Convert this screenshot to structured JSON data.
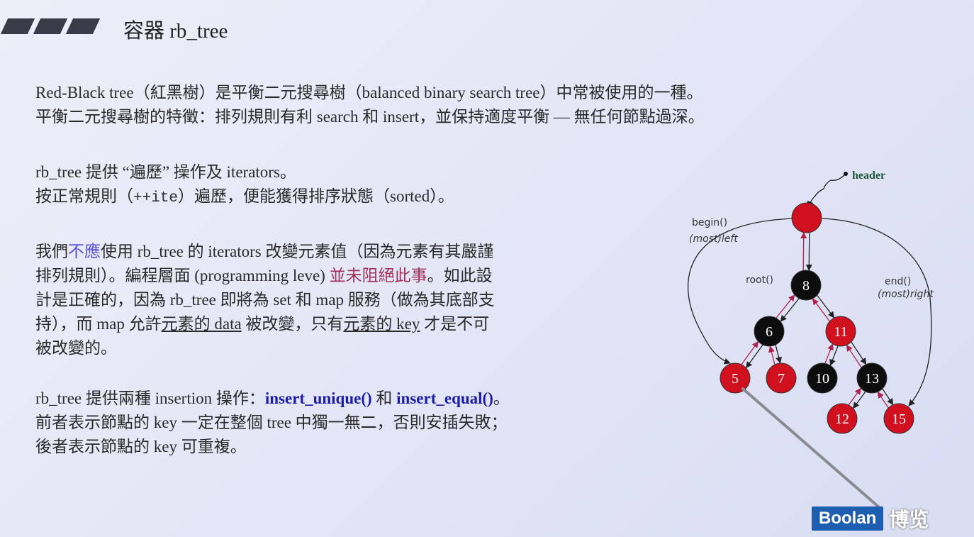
{
  "slide": {
    "title": "容器 rb_tree",
    "paragraphs": [
      [
        [
          {
            "t": "Red-Black tree（紅黑樹）是平衡二元搜尋樹（balanced binary search tree）中常被使用的一種。"
          }
        ],
        [
          {
            "t": "平衡二元搜尋樹的特徵：排列規則有利 search 和 insert，並保持適度平衡 — 無任何節點過深。"
          }
        ]
      ],
      [
        [
          {
            "t": "rb_tree 提供 “遍歷” 操作及 iterators。"
          }
        ],
        [
          {
            "t": "按正常規則（"
          },
          {
            "t": "++ite",
            "s": "mono"
          },
          {
            "t": "）遍歷，便能獲得排序狀態（sorted）。"
          }
        ]
      ],
      [
        [
          {
            "t": "我們"
          },
          {
            "t": "不應",
            "s": "blue"
          },
          {
            "t": "使用 rb_tree 的 iterators 改變元素值（因為元素有其嚴謹"
          }
        ],
        [
          {
            "t": "排列規則）。編程層面 (programming leve) "
          },
          {
            "t": "並未阻絕此事",
            "s": "maroon"
          },
          {
            "t": "。如此設"
          }
        ],
        [
          {
            "t": "計是正確的，因為 rb_tree 即將為 set 和 map 服務（做為其底部支"
          }
        ],
        [
          {
            "t": "持），而 map 允許"
          },
          {
            "t": "元素的 data",
            "s": "ul"
          },
          {
            "t": " 被改變，只有"
          },
          {
            "t": "元素的 key",
            "s": "ul"
          },
          {
            "t": " 才是不可"
          }
        ],
        [
          {
            "t": "被改變的。"
          }
        ]
      ],
      [
        [
          {
            "t": "rb_tree 提供兩種 insertion 操作："
          },
          {
            "t": "insert_unique()",
            "s": "navy"
          },
          {
            "t": " 和 "
          },
          {
            "t": "insert_equal()",
            "s": "navy"
          },
          {
            "t": "。"
          }
        ],
        [
          {
            "t": "前者表示節點的 key 一定在整個 tree 中獨一無二，否則安插失敗；"
          }
        ],
        [
          {
            "t": "後者表示節點的 key 可重複。"
          }
        ]
      ]
    ]
  },
  "diagram": {
    "header_label": "header",
    "begin_label": "begin()",
    "begin_sub": "(most)left",
    "root_label": "root()",
    "end_label": "end()",
    "end_sub": "(most)right",
    "colors": {
      "red": "#d0101e",
      "black": "#0d0d0d",
      "header_green": "#1d5a3a"
    },
    "nodes": [
      {
        "id": "header",
        "key": "",
        "color": "red"
      },
      {
        "id": "n8",
        "key": "8",
        "color": "black"
      },
      {
        "id": "n6",
        "key": "6",
        "color": "black"
      },
      {
        "id": "n11",
        "key": "11",
        "color": "red"
      },
      {
        "id": "n5",
        "key": "5",
        "color": "red"
      },
      {
        "id": "n7",
        "key": "7",
        "color": "red"
      },
      {
        "id": "n10",
        "key": "10",
        "color": "black"
      },
      {
        "id": "n13",
        "key": "13",
        "color": "black"
      },
      {
        "id": "n12",
        "key": "12",
        "color": "red"
      },
      {
        "id": "n15",
        "key": "15",
        "color": "red"
      }
    ],
    "edges": [
      [
        "header",
        "n8"
      ],
      [
        "n8",
        "n6"
      ],
      [
        "n8",
        "n11"
      ],
      [
        "n6",
        "n5"
      ],
      [
        "n6",
        "n7"
      ],
      [
        "n11",
        "n10"
      ],
      [
        "n11",
        "n13"
      ],
      [
        "n13",
        "n12"
      ],
      [
        "n13",
        "n15"
      ]
    ]
  },
  "logo": {
    "brand": "Boolan",
    "brand_cn": "博览"
  }
}
